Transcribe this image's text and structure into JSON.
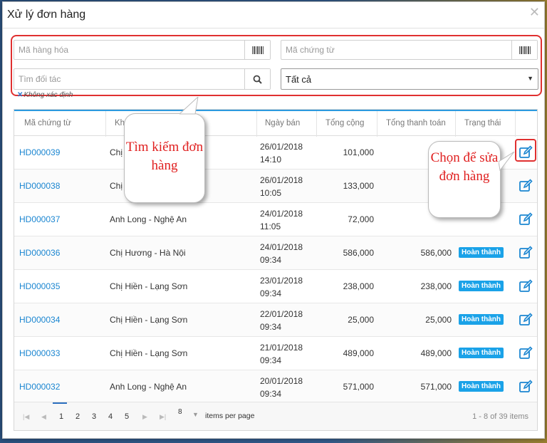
{
  "dialog": {
    "title": "Xử lý đơn hàng",
    "close_icon": "close-icon"
  },
  "filters": {
    "product_code_placeholder": "Mã hàng hóa",
    "document_code_placeholder": "Mã chứng từ",
    "partner_placeholder": "Tìm đối tác",
    "status_select": "Tất cả",
    "chip_label": "Không xác định"
  },
  "table": {
    "headers": [
      "Mã chứng từ",
      "Kh",
      "Ngày bán",
      "Tổng cộng",
      "Tổng thanh toán",
      "Trạng thái"
    ],
    "rows": [
      {
        "code": "HD000039",
        "customer": "Chị",
        "date": "26/01/2018",
        "time": "14:10",
        "total": "101,000",
        "paid": "",
        "status": ""
      },
      {
        "code": "HD000038",
        "customer": "Chị",
        "date": "26/01/2018",
        "time": "10:05",
        "total": "133,000",
        "paid": "",
        "status": ""
      },
      {
        "code": "HD000037",
        "customer": "Anh Long - Nghệ An",
        "date": "24/01/2018",
        "time": "11:05",
        "total": "72,000",
        "paid": "",
        "status": ""
      },
      {
        "code": "HD000036",
        "customer": "Chị Hương - Hà Nội",
        "date": "24/01/2018",
        "time": "09:34",
        "total": "586,000",
        "paid": "586,000",
        "status": "Hoàn thành"
      },
      {
        "code": "HD000035",
        "customer": "Chị Hiền - Lạng Sơn",
        "date": "23/01/2018",
        "time": "09:34",
        "total": "238,000",
        "paid": "238,000",
        "status": "Hoàn thành"
      },
      {
        "code": "HD000034",
        "customer": "Chị Hiền - Lạng Sơn",
        "date": "22/01/2018",
        "time": "09:34",
        "total": "25,000",
        "paid": "25,000",
        "status": "Hoàn thành"
      },
      {
        "code": "HD000033",
        "customer": "Chị Hiền - Lạng Sơn",
        "date": "21/01/2018",
        "time": "09:34",
        "total": "489,000",
        "paid": "489,000",
        "status": "Hoàn thành"
      },
      {
        "code": "HD000032",
        "customer": "Anh Long - Nghệ An",
        "date": "20/01/2018",
        "time": "09:34",
        "total": "571,000",
        "paid": "571,000",
        "status": "Hoàn thành"
      }
    ]
  },
  "pager": {
    "pages": [
      "1",
      "2",
      "3",
      "4",
      "5"
    ],
    "current_page": "1",
    "per_page": "8",
    "per_page_label": "items per page",
    "range": "1 - 8 of 39 items"
  },
  "callouts": {
    "search": "Tìm kiếm đơn hàng",
    "edit": "Chọn để sửa đơn hàng"
  },
  "colors": {
    "accent": "#1b86d1",
    "badge": "#1aa2e8",
    "highlight": "#e03030"
  }
}
